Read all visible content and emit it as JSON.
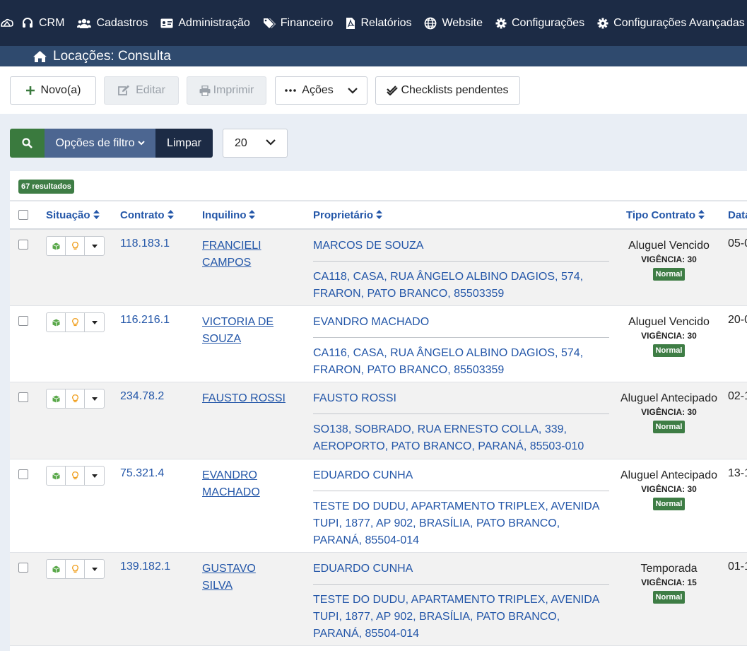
{
  "nav": {
    "items": [
      {
        "label": "CRM",
        "icon": "headset-icon"
      },
      {
        "label": "Cadastros",
        "icon": "users-icon"
      },
      {
        "label": "Administração",
        "icon": "id-card-icon"
      },
      {
        "label": "Financeiro",
        "icon": "tags-icon"
      },
      {
        "label": "Relatórios",
        "icon": "pdf-file-icon"
      },
      {
        "label": "Website",
        "icon": "globe-icon"
      },
      {
        "label": "Configurações",
        "icon": "gear-icon"
      },
      {
        "label": "Configurações Avançadas",
        "icon": "gear-icon"
      }
    ]
  },
  "page": {
    "title": "Locações: Consulta"
  },
  "toolbar": {
    "novo": "Novo(a)",
    "editar": "Editar",
    "imprimir": "Imprimir",
    "acoes": "Ações",
    "checklists": "Checklists pendentes"
  },
  "filter": {
    "options": "Opções de filtro",
    "clear": "Limpar",
    "per_page": "20"
  },
  "results": {
    "count_label": "67 resultados"
  },
  "table": {
    "headers": {
      "situacao": "Situação",
      "contrato": "Contrato",
      "inquilino": "Inquilino",
      "proprietario": "Proprietário",
      "tipo": "Tipo Contrato",
      "data": "Data"
    },
    "rows": [
      {
        "contrato": "118.183.1",
        "inquilino": "FRANCIELI CAMPOS",
        "proprietario": "MARCOS DE SOUZA",
        "endereco": "CA118, CASA, RUA ÂNGELO ALBINO DAGIOS, 574, FRARON, PATO BRANCO, 85503359",
        "tipo": "Aluguel Vencido",
        "vigencia_label": "VIGÊNCIA:",
        "vigencia": "30",
        "status": "Normal",
        "data": "05-0"
      },
      {
        "contrato": "116.216.1",
        "inquilino": "VICTORIA DE SOUZA",
        "proprietario": "EVANDRO MACHADO",
        "endereco": "CA116, CASA, RUA ÂNGELO ALBINO DAGIOS, 574, FRARON, PATO BRANCO, 85503359",
        "tipo": "Aluguel Vencido",
        "vigencia_label": "VIGÊNCIA:",
        "vigencia": "30",
        "status": "Normal",
        "data": "20-0"
      },
      {
        "contrato": "234.78.2",
        "inquilino": "FAUSTO ROSSI",
        "proprietario": "FAUSTO ROSSI",
        "endereco": "SO138, SOBRADO, RUA ERNESTO COLLA, 339, AEROPORTO, PATO BRANCO, PARANÁ, 85503-010",
        "tipo": "Aluguel Antecipado",
        "vigencia_label": "VIGÊNCIA:",
        "vigencia": "30",
        "status": "Normal",
        "data": "02-1"
      },
      {
        "contrato": "75.321.4",
        "inquilino": "EVANDRO MACHADO",
        "proprietario": "EDUARDO CUNHA",
        "endereco": "TESTE DO DUDU, APARTAMENTO TRIPLEX, AVENIDA TUPI, 1877, AP 902, BRASÍLIA, PATO BRANCO, PARANÁ, 85504-014",
        "tipo": "Aluguel Antecipado",
        "vigencia_label": "VIGÊNCIA:",
        "vigencia": "30",
        "status": "Normal",
        "data": "13-1"
      },
      {
        "contrato": "139.182.1",
        "inquilino": "GUSTAVO SILVA",
        "proprietario": "EDUARDO CUNHA",
        "endereco": "TESTE DO DUDU, APARTAMENTO TRIPLEX, AVENIDA TUPI, 1877, AP 902, BRASÍLIA, PATO BRANCO, PARANÁ, 85504-014",
        "tipo": "Temporada",
        "vigencia_label": "VIGÊNCIA:",
        "vigencia": "15",
        "status": "Normal",
        "data": "01-1"
      }
    ]
  },
  "colors": {
    "nav_bg": "#1c2b45",
    "title_bg": "#2f4a6e",
    "link": "#2356a8",
    "success": "#3e7d45",
    "filter_options": "#4c6691"
  }
}
